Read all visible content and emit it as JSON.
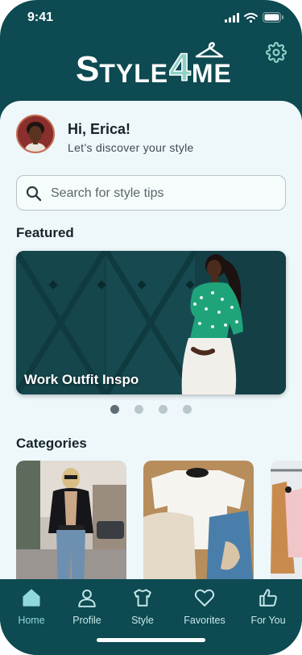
{
  "status_bar": {
    "time": "9:41"
  },
  "header": {
    "logo": {
      "part1": "S",
      "part2": "TYLE",
      "part3": "4",
      "part4": "ME"
    },
    "settings_icon": "gear-icon"
  },
  "greeting": {
    "title": "Hi, Erica!",
    "subtitle": "Let’s discover your style"
  },
  "search": {
    "placeholder": "Search for style tips",
    "value": ""
  },
  "featured": {
    "heading": "Featured",
    "card_caption": "Work Outfit Inspo",
    "carousel": {
      "total": 4,
      "active_index": 0
    }
  },
  "categories": {
    "heading": "Categories"
  },
  "tab_bar": {
    "items": [
      {
        "label": "Home",
        "icon": "home-icon",
        "active": true
      },
      {
        "label": "Profile",
        "icon": "person-icon",
        "active": false
      },
      {
        "label": "Style",
        "icon": "shirt-icon",
        "active": false
      },
      {
        "label": "Favorites",
        "icon": "heart-icon",
        "active": false
      },
      {
        "label": "For You",
        "icon": "thumbs-up-icon",
        "active": false
      }
    ]
  },
  "colors": {
    "primary": "#0d4a52",
    "accent": "#8fd1c6",
    "background": "#eef8fb"
  }
}
